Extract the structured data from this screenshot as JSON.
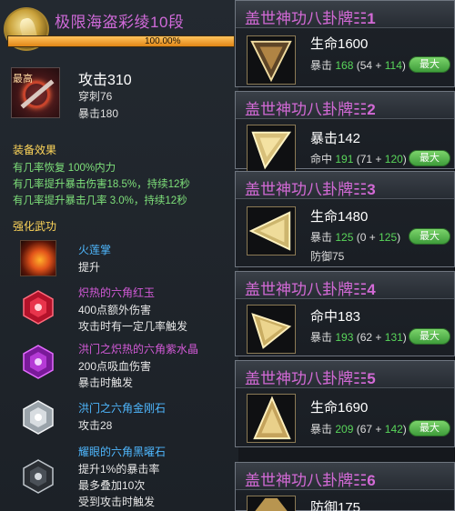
{
  "header": {
    "title": "极限海盗彩绫10段",
    "progress_text": "100.00%",
    "progress": 1.0,
    "icon": "gold-emblem-icon"
  },
  "weapon": {
    "tag": "最高",
    "attack": "攻击310",
    "pierce": "穿刺76",
    "crit": "暴击180",
    "icon": "weapon-icon"
  },
  "equip_effects": {
    "title": "装备效果",
    "lines": [
      "有几率恢复 100%内力",
      "有几率提升暴击伤害18.5%，持续12秒",
      "有几率提升暴击几率 3.0%，持续12秒"
    ]
  },
  "martial": {
    "title": "强化武功",
    "items": [
      {
        "name": "火莲掌",
        "lines": [
          "提升"
        ],
        "icon": "fire-palm-icon",
        "color": "blue"
      },
      {
        "name": "炽热的六角红玉",
        "lines": [
          "400点额外伤害",
          "攻击时有一定几率触发"
        ],
        "icon": "red-hexagon-gem-icon",
        "color": "purple"
      },
      {
        "name": "洪门之炽热的六角紫水晶",
        "lines": [
          "200点吸血伤害",
          "暴击时触发"
        ],
        "icon": "purple-hexagon-gem-icon",
        "color": "purple"
      },
      {
        "name": "洪门之六角金刚石",
        "lines": [
          "攻击28"
        ],
        "icon": "diamond-gem-icon",
        "color": "blue"
      },
      {
        "name": "耀眼的六角黑曜石",
        "lines": [
          "提升1%的暴击率",
          "最多叠加10次",
          "受到攻击时触发"
        ],
        "icon": "obsidian-gem-icon",
        "color": "blue"
      }
    ]
  },
  "cards": [
    {
      "title": "盖世神功八卦牌",
      "num": "☷1",
      "main": "生命1600",
      "sub": [
        {
          "label": "暴击",
          "value": "168",
          "detail": "(54 + ",
          "bonus": "114",
          "end": ")"
        }
      ],
      "badge": "最大",
      "icon": "bagua-card-icon"
    },
    {
      "title": "盖世神功八卦牌",
      "num": "☷2",
      "main": "暴击142",
      "sub": [
        {
          "label": "命中",
          "value": "191",
          "detail": "(71 + ",
          "bonus": "120",
          "end": ")"
        }
      ],
      "badge": "最大",
      "icon": "bagua-card-icon"
    },
    {
      "title": "盖世神功八卦牌",
      "num": "☷3",
      "main": "生命1480",
      "sub": [
        {
          "label": "暴击",
          "value": "125",
          "detail": "(0 + ",
          "bonus": "125",
          "end": ")"
        },
        {
          "label": "防御75"
        }
      ],
      "badge": "最大",
      "icon": "bagua-card-icon"
    },
    {
      "title": "盖世神功八卦牌",
      "num": "☷4",
      "main": "命中183",
      "sub": [
        {
          "label": "暴击",
          "value": "193",
          "detail": "(62 + ",
          "bonus": "131",
          "end": ")"
        }
      ],
      "badge": "最大",
      "icon": "bagua-card-icon"
    },
    {
      "title": "盖世神功八卦牌",
      "num": "☷5",
      "main": "生命1690",
      "sub": [
        {
          "label": "暴击",
          "value": "209",
          "detail": "(67 + ",
          "bonus": "142",
          "end": ")"
        }
      ],
      "badge": "最大",
      "icon": "bagua-card-icon"
    },
    {
      "title": "盖世神功八卦牌",
      "num": "☷6",
      "main": "防御175",
      "sub": [],
      "badge": "",
      "icon": "bagua-card-icon"
    }
  ]
}
